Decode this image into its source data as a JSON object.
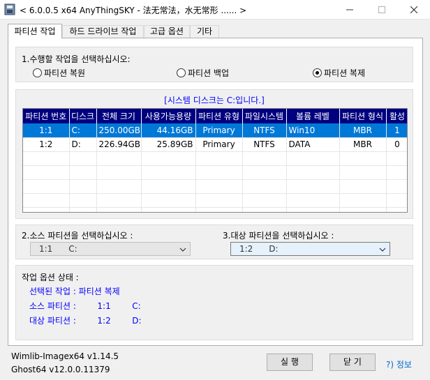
{
  "window": {
    "title": "< 6.0.0.5 x64 AnyThingSKY - 法无常法，水无常形 ...... >",
    "controls": {
      "minimize": "—",
      "maximize": "☐",
      "close": "✕"
    }
  },
  "tabs": [
    "파티션 작업",
    "하드 드라이브 작업",
    "고급 옵션",
    "기타"
  ],
  "task": {
    "prompt": "1.수행할 작업을 선택하십시오:",
    "options": [
      "파티션 복원",
      "파티션 백업",
      "파티션 복제"
    ],
    "selected": "파티션 복제"
  },
  "partitions": {
    "notice": "[시스템 디스크는 C:입니다.]",
    "columns": [
      "파티션 번호",
      "디스크",
      "전체 크기",
      "사용가능용량",
      "파티션 유형",
      "파일시스템",
      "볼륨 레벨",
      "파티션 형식",
      "활성"
    ],
    "rows": [
      [
        "1:1",
        "C:",
        "250.00GB",
        "44.16GB",
        "Primary",
        "NTFS",
        "Win10",
        "MBR",
        "1"
      ],
      [
        "1:2",
        "D:",
        "226.94GB",
        "25.89GB",
        "Primary",
        "NTFS",
        "DATA",
        "MBR",
        "0"
      ]
    ],
    "selected_row": 0
  },
  "source": {
    "label": "2.소스 파티션을 선택하십시오 :",
    "value": "1:1      C:"
  },
  "target": {
    "label": "3.대상 파티션을 선택하십시오 :",
    "value": "1:2      D:"
  },
  "status": {
    "title": "작업 옵션 상태 :",
    "lines": [
      "선택된 작업 : 파티션 복제",
      "소스 파티션 :        1:1        C:",
      "대상 파티션 :        1:2        D:"
    ]
  },
  "versions": [
    "Wimlib-Imagex64 v1.14.5",
    "Ghost64 v12.0.0.11379"
  ],
  "buttons": {
    "run": "실 행",
    "close": "닫 기",
    "help": "?) 정보"
  },
  "colors": {
    "selection": "#0078d7",
    "header": "#00007f",
    "status_text": "#0000ff",
    "help_link": "#0066cc"
  }
}
